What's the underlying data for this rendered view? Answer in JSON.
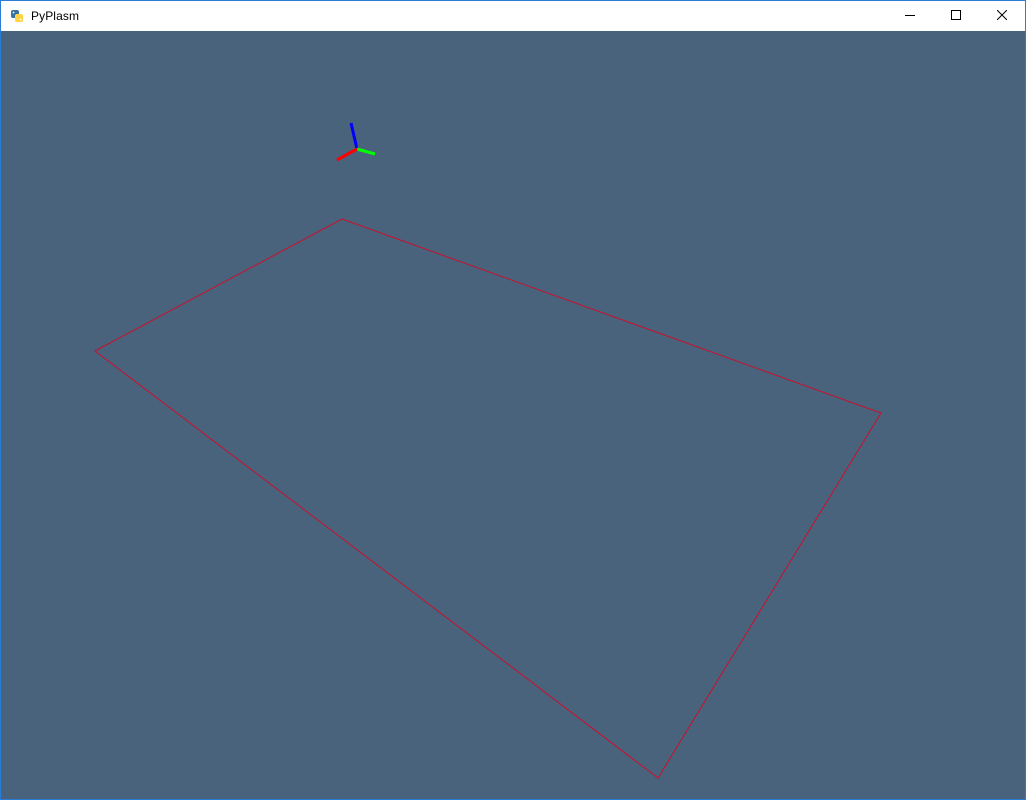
{
  "window": {
    "title": "PyPlasm",
    "app_icon": "python-icon",
    "controls": {
      "minimize_icon": "minimize-icon",
      "maximize_icon": "maximize-icon",
      "close_icon": "close-icon"
    }
  },
  "scene": {
    "background_color": "#4a637c",
    "shape_color": "#c8102e",
    "axis_colors": {
      "x": "#ff0000",
      "y": "#00ff00",
      "z": "#0000ff"
    }
  }
}
